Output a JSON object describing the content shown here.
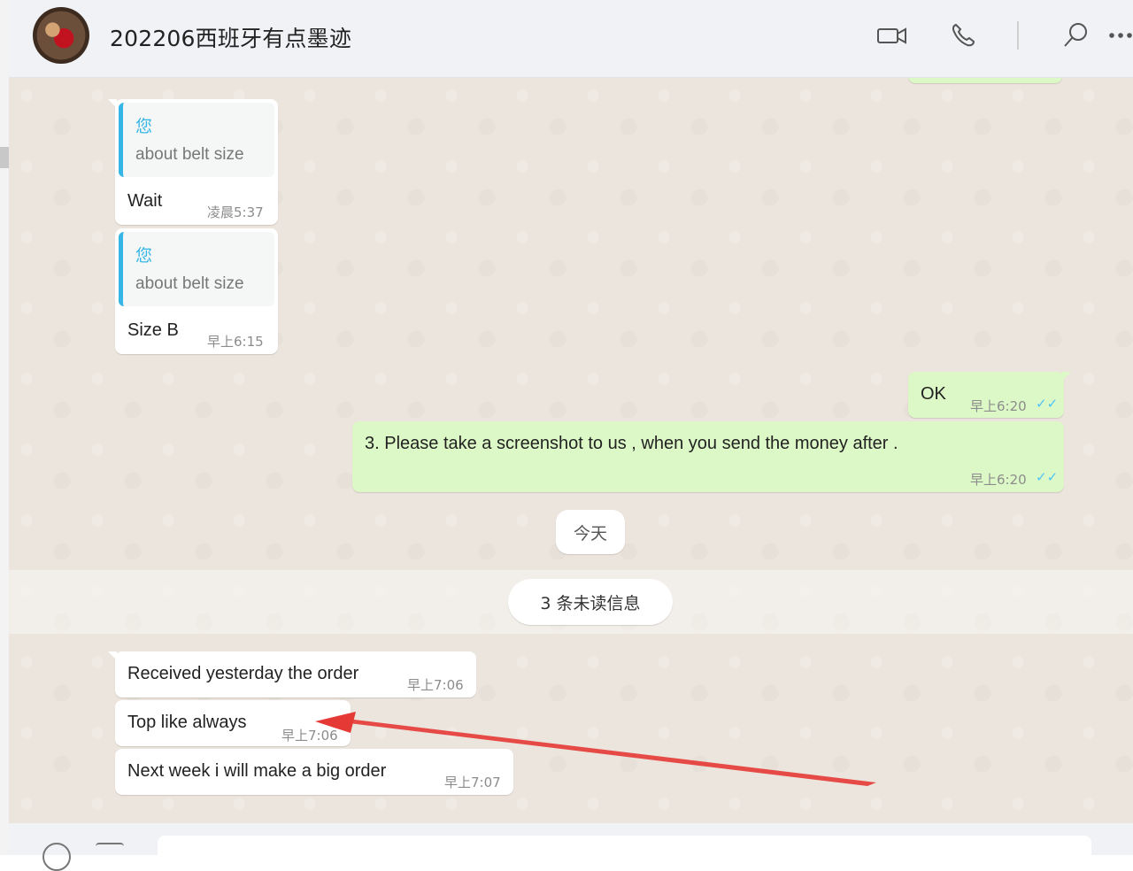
{
  "header": {
    "title": "202206西班牙有点墨迹",
    "icons": [
      "video-call-icon",
      "voice-call-icon",
      "search-icon",
      "more-options-icon"
    ]
  },
  "colors": {
    "incoming_bubble": "#ffffff",
    "outgoing_bubble": "#dcf8c6",
    "chat_background": "#ece5dd",
    "quote_accent": "#35b6e6",
    "read_tick": "#4fc3f7",
    "arrow": "#e53935"
  },
  "messages": [
    {
      "direction": "in",
      "quote_author": "您",
      "quote_text": "about belt size",
      "text": "Wait",
      "time": "凌晨5:37"
    },
    {
      "direction": "in",
      "quote_author": "您",
      "quote_text": "about belt size",
      "text": "Size B",
      "time": "早上6:15"
    },
    {
      "direction": "out",
      "text": "OK",
      "time": "早上6:20",
      "status": "read"
    },
    {
      "direction": "out",
      "text": "3. Please take a screenshot to us , when you send the money after .",
      "time": "早上6:20",
      "status": "read"
    },
    {
      "direction": "in",
      "text": "Received yesterday the order",
      "time": "早上7:06"
    },
    {
      "direction": "in",
      "text": "Top like always",
      "time": "早上7:06"
    },
    {
      "direction": "in",
      "text": "Next week i will make a big order",
      "time": "早上7:07"
    }
  ],
  "date_divider": "今天",
  "unread_divider": "3 条未读信息",
  "ticks": "✓✓"
}
